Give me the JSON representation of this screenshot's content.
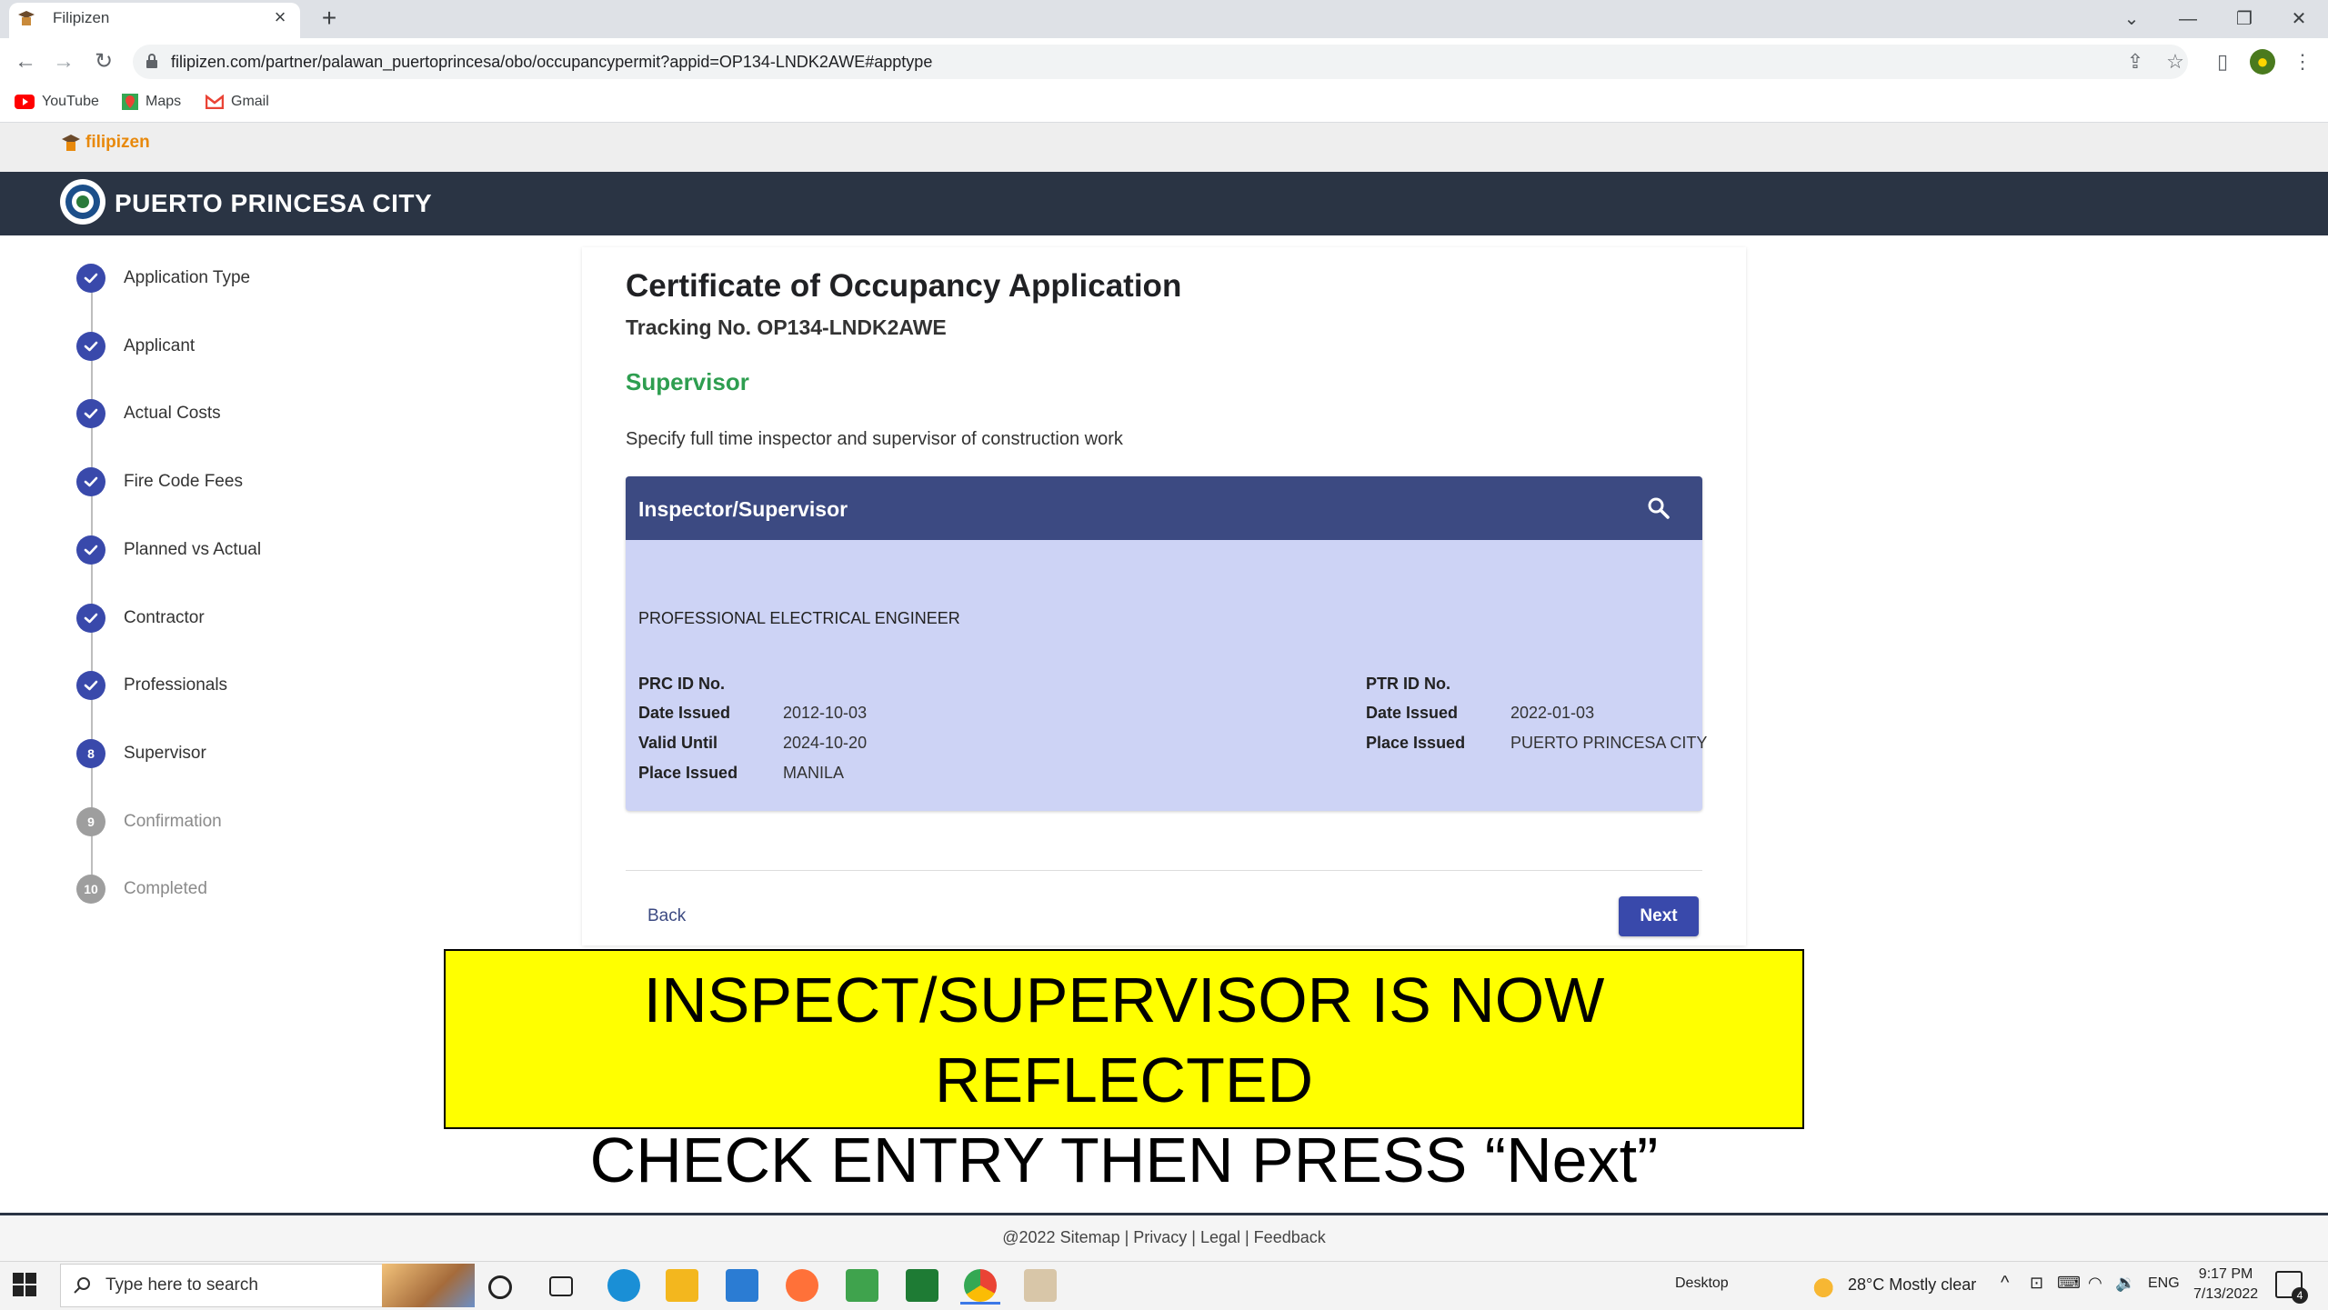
{
  "browser": {
    "tab_title": "Filipizen",
    "url": "filipizen.com/partner/palawan_puertoprincesa/obo/occupancypermit?appid=OP134-LNDK2AWE#apptype",
    "bookmarks": [
      "YouTube",
      "Maps",
      "Gmail"
    ]
  },
  "site": {
    "logo_text": "filipizen",
    "city_name": "PUERTO PRINCESA CITY"
  },
  "stepper": {
    "steps": [
      {
        "label": "Application Type",
        "state": "done",
        "marker": ""
      },
      {
        "label": "Applicant",
        "state": "done",
        "marker": ""
      },
      {
        "label": "Actual Costs",
        "state": "done",
        "marker": ""
      },
      {
        "label": "Fire Code Fees",
        "state": "done",
        "marker": ""
      },
      {
        "label": "Planned vs Actual",
        "state": "done",
        "marker": ""
      },
      {
        "label": "Contractor",
        "state": "done",
        "marker": ""
      },
      {
        "label": "Professionals",
        "state": "done",
        "marker": ""
      },
      {
        "label": "Supervisor",
        "state": "current",
        "marker": "8"
      },
      {
        "label": "Confirmation",
        "state": "todo",
        "marker": "9"
      },
      {
        "label": "Completed",
        "state": "todo",
        "marker": "10"
      }
    ]
  },
  "main": {
    "title": "Certificate of Occupancy Application",
    "tracking": "Tracking No. OP134-LNDK2AWE",
    "section_title": "Supervisor",
    "section_desc": "Specify full time inspector and supervisor of construction work",
    "panel": {
      "title": "Inspector/Supervisor",
      "profession": "PROFESSIONAL ELECTRICAL ENGINEER",
      "prc": {
        "id_label": "PRC ID No.",
        "date_issued_label": "Date Issued",
        "date_issued": "2012-10-03",
        "valid_until_label": "Valid Until",
        "valid_until": "2024-10-20",
        "place_issued_label": "Place Issued",
        "place_issued": "MANILA"
      },
      "ptr": {
        "id_label": "PTR ID No.",
        "date_issued_label": "Date Issued",
        "date_issued": "2022-01-03",
        "place_issued_label": "Place Issued",
        "place_issued": "PUERTO PRINCESA CITY"
      }
    },
    "back_label": "Back",
    "next_label": "Next"
  },
  "annotation": {
    "line1": "INSPECT/SUPERVISOR IS NOW REFLECTED",
    "line2": "CHECK ENTRY THEN PRESS “Next”"
  },
  "footer": {
    "text": "@2022 Sitemap | Privacy | Legal | Feedback"
  },
  "taskbar": {
    "search_placeholder": "Type here to search",
    "desktop_label": "Desktop",
    "weather": "28°C  Mostly clear",
    "language": "ENG",
    "time": "9:17 PM",
    "date": "7/13/2022",
    "notifications": "4"
  },
  "colors": {
    "header_dark": "#2a3444",
    "accent": "#3949ab",
    "section_green": "#2e9e50",
    "panel_bg": "#cdd3f5",
    "panel_head": "#3c4a82",
    "annotation_yellow": "#ffff00"
  }
}
